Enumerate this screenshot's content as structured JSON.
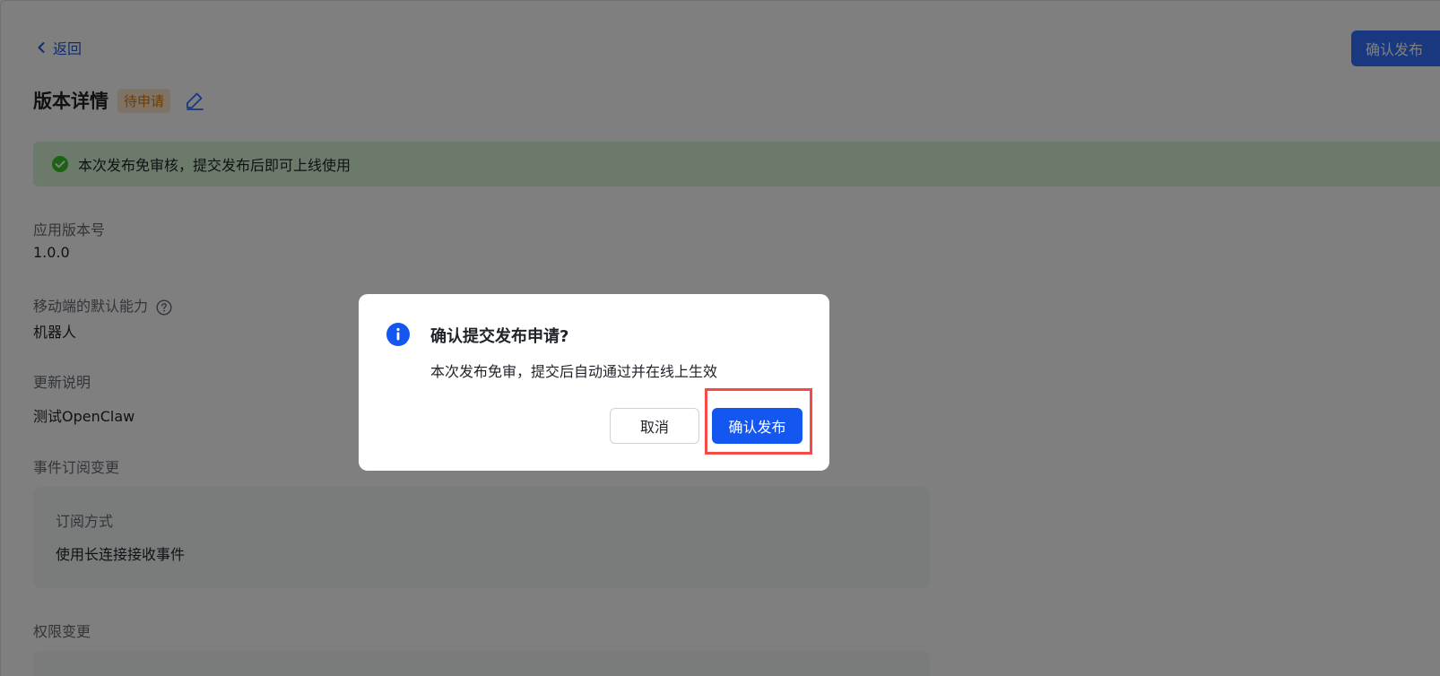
{
  "header": {
    "back_label": "返回",
    "confirm_publish_label": "确认发布"
  },
  "page": {
    "title": "版本详情",
    "status": "待申请"
  },
  "notice": {
    "text": "本次发布免审核，提交发布后即可上线使用"
  },
  "fields": {
    "version_label": "应用版本号",
    "version_value": "1.0.0",
    "mobile_default_label": "移动端的默认能力",
    "mobile_default_value": "机器人",
    "update_notes_label": "更新说明",
    "update_notes_value": "测试OpenClaw",
    "event_change_label": "事件订阅变更",
    "subscription_mode_label": "订阅方式",
    "subscription_mode_value": "使用长连接接收事件",
    "permission_change_label": "权限变更"
  },
  "dialog": {
    "title": "确认提交发布申请?",
    "description": "本次发布免审，提交后自动通过并在线上生效",
    "cancel_label": "取消",
    "confirm_label": "确认发布"
  },
  "colors": {
    "primary": "#3370ff",
    "dialog_primary": "#1456f0",
    "status_text": "#de7802",
    "status_bg": "#fee7cd",
    "success": "#34c724",
    "highlight": "#f54a45"
  },
  "icons": {
    "back": "chevron-left-icon",
    "edit": "pencil-icon",
    "notice": "check-circle-icon",
    "help": "question-circle-icon",
    "dialog": "info-circle-icon"
  }
}
